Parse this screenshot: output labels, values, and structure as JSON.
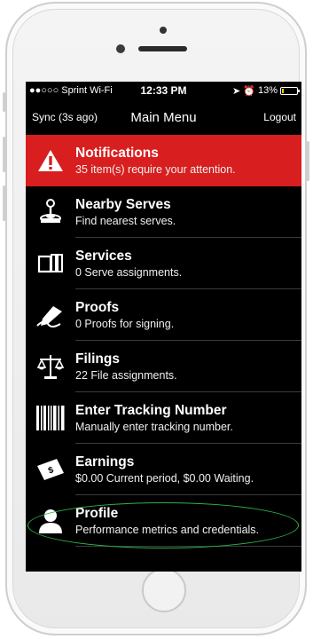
{
  "status_bar": {
    "carrier": "●●○○○ Sprint Wi-Fi",
    "time": "12:33 PM",
    "battery_percent": "13%",
    "battery_level": 0.13
  },
  "nav": {
    "left": "Sync (3s ago)",
    "title": "Main Menu",
    "right": "Logout"
  },
  "menu": [
    {
      "title": "Notifications",
      "subtitle": "35 item(s) require your attention.",
      "icon": "warning-icon"
    },
    {
      "title": "Nearby Serves",
      "subtitle": "Find nearest serves.",
      "icon": "joystick-icon"
    },
    {
      "title": "Services",
      "subtitle": "0 Serve assignments.",
      "icon": "documents-icon"
    },
    {
      "title": "Proofs",
      "subtitle": "0 Proofs for signing.",
      "icon": "signature-pen-icon"
    },
    {
      "title": "Filings",
      "subtitle": "22 File assignments.",
      "icon": "scales-icon"
    },
    {
      "title": "Enter Tracking Number",
      "subtitle": "Manually enter tracking number.",
      "icon": "barcode-icon"
    },
    {
      "title": "Earnings",
      "subtitle": "$0.00 Current period, $0.00 Waiting.",
      "icon": "money-icon"
    },
    {
      "title": "Profile",
      "subtitle": "Performance metrics and credentials.",
      "icon": "person-icon"
    }
  ],
  "colors": {
    "alert_red": "#d81e1e",
    "highlight_green": "#2db34a",
    "battery_yellow": "#f5d000"
  }
}
